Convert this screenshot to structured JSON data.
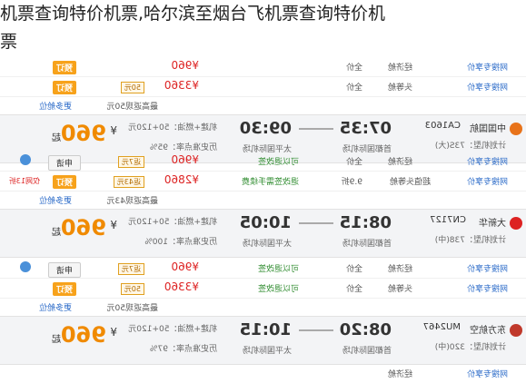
{
  "page": {
    "title_line1": "机票查询特价机票,哈尔滨至烟台飞机票查询特价机",
    "title_line2": "票"
  },
  "sub_rows_top": [
    {
      "site": "网搜专享价",
      "cabin": "经济舱",
      "discount": "全价",
      "price": "¥960",
      "tag": "预订",
      "badge": ""
    },
    {
      "site": "网搜专享价",
      "cabin": "头等舱",
      "discount": "全价",
      "price": "¥3360",
      "tag": "预订",
      "badge": "50元"
    }
  ],
  "more_labels": [
    {
      "text": "更多舱位",
      "note": "最高返现50元"
    },
    {
      "text": "更多舱位",
      "note": "最高返现43元"
    },
    {
      "text": "更多舱位",
      "note": "最高返现50元"
    }
  ],
  "flights": [
    {
      "airline": "中国国航",
      "code": "CA1603",
      "plane": "计划机型：73S(大)",
      "dep_time": "07:35",
      "dep_airport": "首都国际机场",
      "arr_time": "09:30",
      "arr_airport": "太平国际机场",
      "tax": "机建+燃油：50+120元",
      "ontime": "历史准点率：95%",
      "price": "960",
      "price_prefix": "¥",
      "price_suffix": "起",
      "button": "预订"
    },
    {
      "airline": "大新华",
      "code": "CN7127",
      "plane": "计划机型：738(中)",
      "dep_time": "08:15",
      "dep_airport": "首都国际机场",
      "arr_time": "10:05",
      "arr_airport": "太平国际机场",
      "tax": "机建+燃油：50+120元",
      "ontime": "历史准点率：100%",
      "price": "960",
      "price_prefix": "¥",
      "price_suffix": "起",
      "button": "预订"
    },
    {
      "airline": "东方航空",
      "code": "MU2467",
      "plane": "计划机型：320(中)",
      "dep_time": "08:20",
      "dep_airport": "首都国际机场",
      "arr_time": "10:15",
      "arr_airport": "太平国际机场",
      "tax": "机建+燃油：50+120元",
      "ontime": "历史准点率：97%",
      "price": "960",
      "price_prefix": "¥",
      "price_suffix": "起",
      "button": "预订"
    }
  ],
  "sub_rows_mid1": [
    {
      "site": "网搜专享价",
      "cabin": "经济舱",
      "status": "可以退改签",
      "discount": "全价",
      "price": "¥960",
      "tag": "申请",
      "badge": "返7元"
    },
    {
      "site": "网搜专享价",
      "cabin": "超值头等舱",
      "discount": "9.9折",
      "status": "退改签需手续费",
      "price": "¥2860",
      "tag": "预订",
      "badge": "返43元",
      "promo": "仅网13折"
    }
  ],
  "sub_rows_mid2": [
    {
      "site": "网搜专享价",
      "cabin": "经济舱",
      "status": "可以退改签",
      "discount": "全价",
      "price": "¥960",
      "tag": "申请",
      "badge": "返7元"
    },
    {
      "site": "网搜专享价",
      "cabin": "头等舱",
      "status": "可以退改签",
      "discount": "全价",
      "price": "¥3360",
      "tag": "预订",
      "badge": "50元"
    }
  ],
  "sub_rows_bottom": [
    {
      "site": "网搜专享价",
      "cabin": "经济舱",
      "status": "可以退改签",
      "discount": "全价",
      "price": "¥960",
      "tag": "申请",
      "badge": "返7元"
    }
  ]
}
